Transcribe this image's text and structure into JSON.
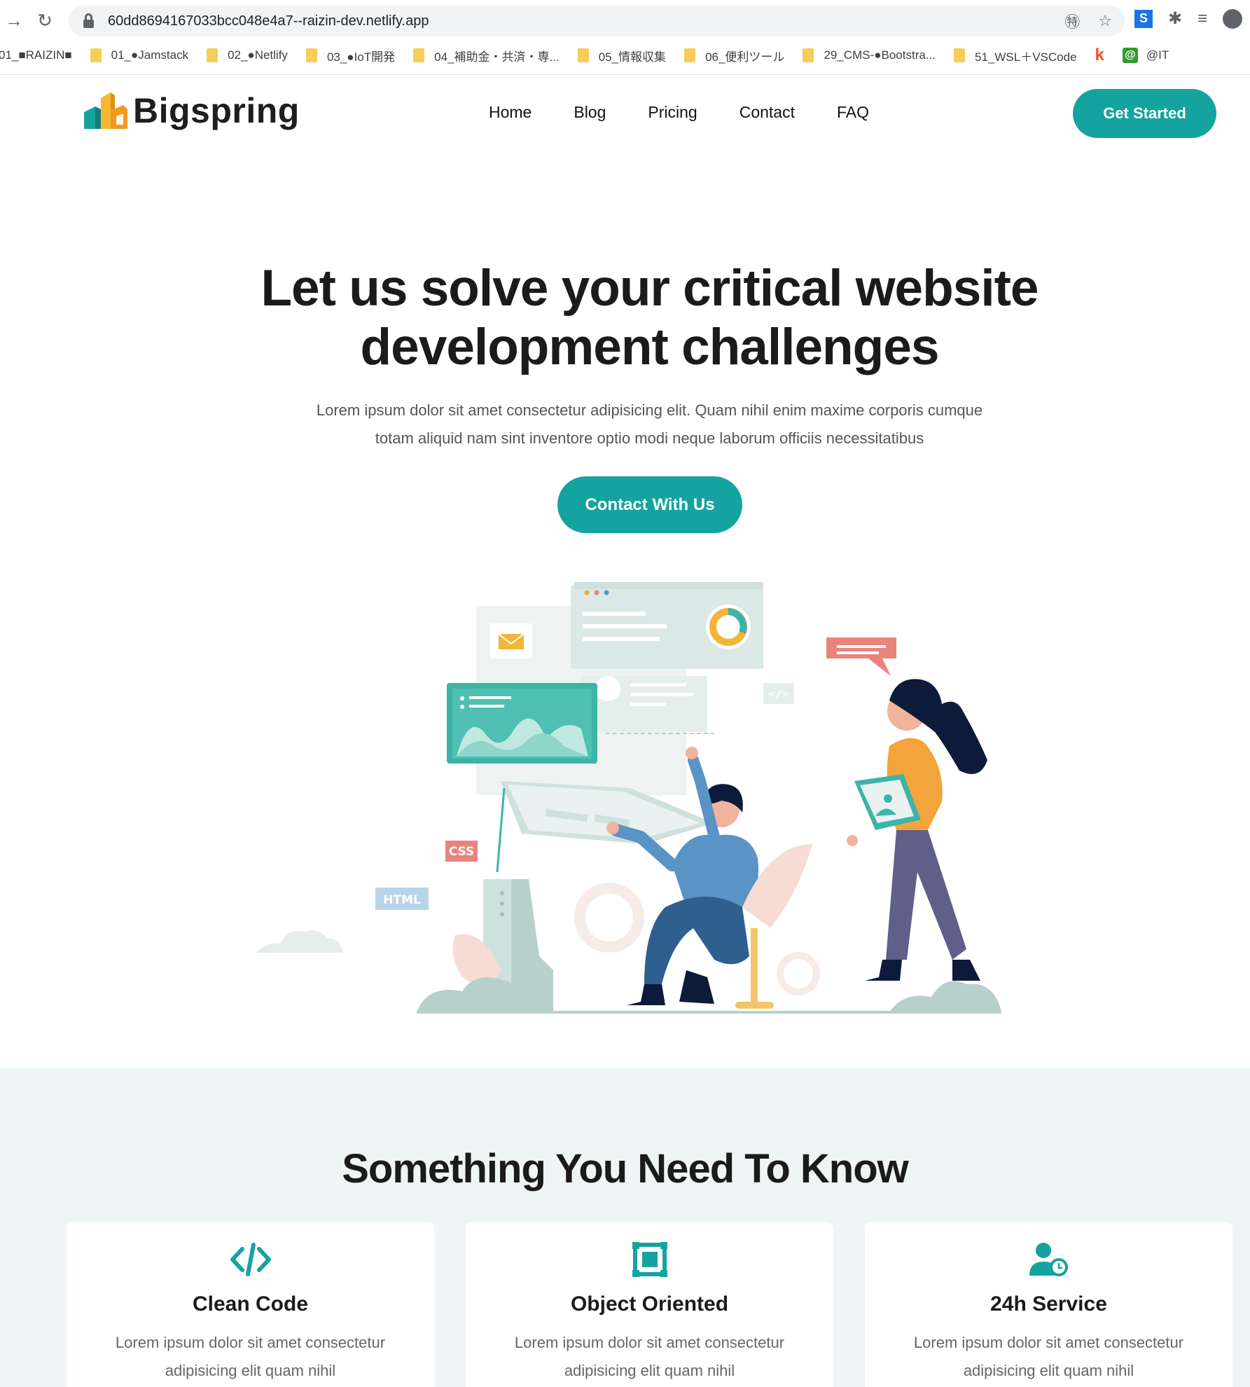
{
  "browser": {
    "url": "60dd8694167033bcc048e4a7--raizin-dev.netlify.app",
    "bookmarks": [
      "01_■RAIZIN■",
      "01_●Jamstack",
      "02_●Netlify",
      "03_●IoT開発",
      "04_補助金・共済・専...",
      "05_情報収集",
      "06_便利ツール",
      "29_CMS-●Bootstra...",
      "51_WSL＋VSCode"
    ],
    "bookmark_at_label": "@IT"
  },
  "header": {
    "logo_text": "Bigspring",
    "nav": [
      "Home",
      "Blog",
      "Pricing",
      "Contact",
      "FAQ"
    ],
    "cta_label": "Get Started"
  },
  "hero": {
    "title_line1": "Let us solve your critical website",
    "title_line2": "development challenges",
    "subtitle_line1": "Lorem ipsum dolor sit amet consectetur adipisicing elit. Quam nihil enim maxime corporis cumque",
    "subtitle_line2": "totam aliquid nam sint inventore optio modi neque laborum officiis necessitatibus",
    "cta_label": "Contact With Us",
    "illustration": {
      "labels": [
        "</>",
        "CSS",
        "HTML"
      ]
    }
  },
  "features": {
    "title": "Something You Need To Know",
    "cards": [
      {
        "icon": "code-icon",
        "title": "Clean Code",
        "text_line1": "Lorem ipsum dolor sit amet consectetur",
        "text_line2": "adipisicing elit quam nihil"
      },
      {
        "icon": "object-icon",
        "title": "Object Oriented",
        "text_line1": "Lorem ipsum dolor sit amet consectetur",
        "text_line2": "adipisicing elit quam nihil"
      },
      {
        "icon": "user-clock-icon",
        "title": "24h Service",
        "text_line1": "Lorem ipsum dolor sit amet consectetur",
        "text_line2": "adipisicing elit quam nihil"
      }
    ]
  },
  "colors": {
    "accent": "#15a3a0",
    "features_bg": "#eef6f5"
  }
}
